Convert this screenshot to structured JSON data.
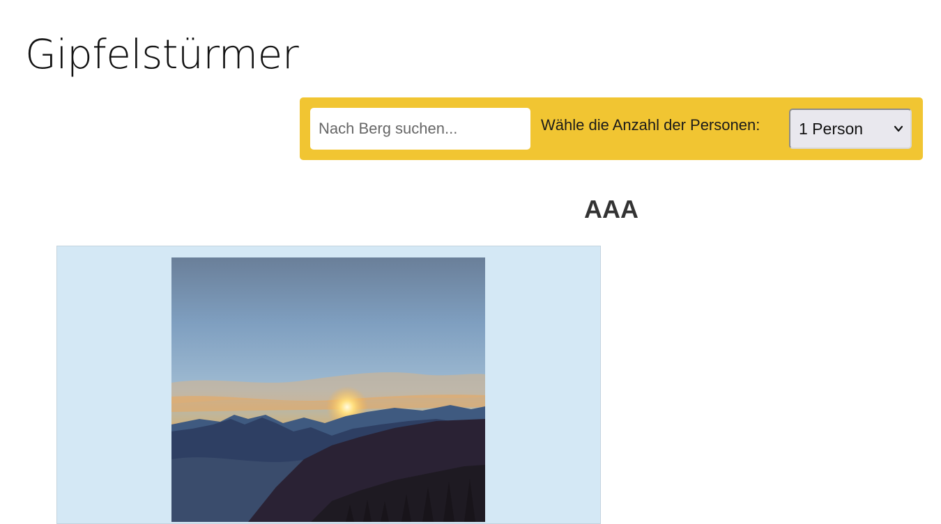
{
  "header": {
    "title": "Gipfelstürmer"
  },
  "filters": {
    "search_placeholder": "Nach Berg suchen...",
    "persons_label": "Wähle die Anzahl der Personen:",
    "persons_selected": "1 Person"
  },
  "section": {
    "heading": "AAA"
  },
  "colors": {
    "filter_bar": "#f1c532",
    "card_background": "#d4e8f5"
  },
  "icons": {
    "select_arrow": "chevron-down-icon"
  }
}
